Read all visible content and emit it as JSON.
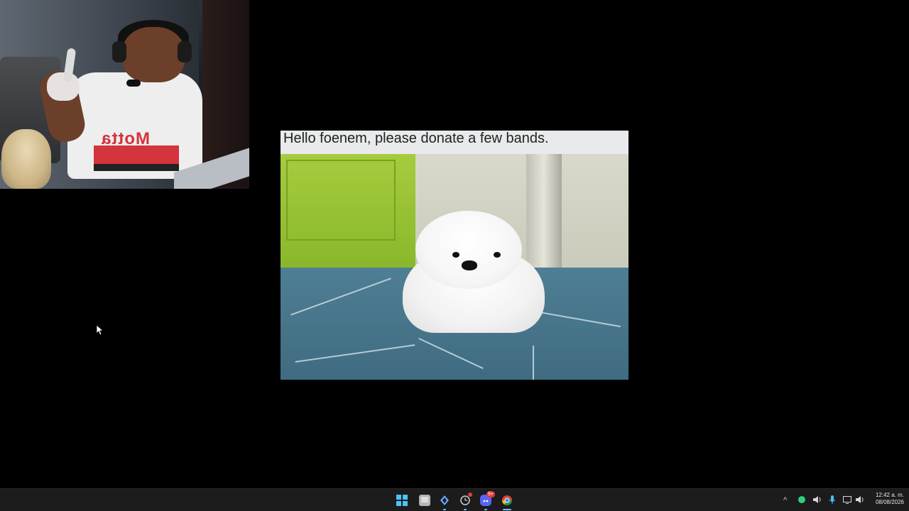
{
  "stream": {
    "alert": {
      "message": "Hello foenem, please donate a few bands."
    }
  },
  "taskbar": {
    "apps": [
      {
        "name": "Start"
      },
      {
        "name": "File Explorer"
      },
      {
        "name": "Aura app"
      },
      {
        "name": "Clock app",
        "badge_color": "#e23b3b"
      },
      {
        "name": "Discord",
        "badge": "9+"
      },
      {
        "name": "Google Chrome"
      }
    ],
    "tray": {
      "clock_time": "12:42 a. m.",
      "clock_date": "08/08/2026"
    }
  },
  "colors": {
    "accent": "#4cc2ff",
    "taskbar_bg": "#1c1c1c",
    "status_green": "#2fd07a"
  }
}
